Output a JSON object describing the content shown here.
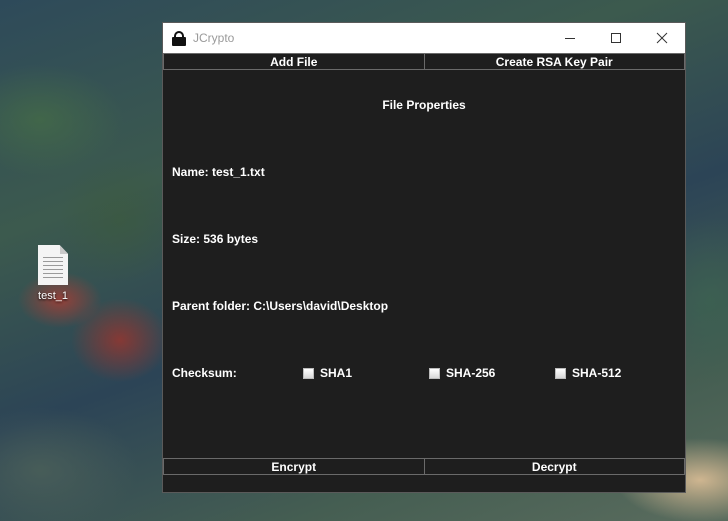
{
  "desktop": {
    "icon_label": "test_1",
    "icon": "text-file-icon"
  },
  "window": {
    "title": "JCrypto",
    "icon": "lock-icon",
    "controls": [
      "minimize-icon",
      "maximize-icon",
      "close-icon"
    ]
  },
  "toolbar": {
    "add_file": "Add File",
    "create_rsa": "Create RSA Key Pair"
  },
  "properties": {
    "heading": "File Properties",
    "name": "Name: test_1.txt",
    "size": "Size: 536 bytes",
    "parent": "Parent folder: C:\\Users\\david\\Desktop"
  },
  "checksum": {
    "label": "Checksum:",
    "options": [
      {
        "label": "SHA1",
        "checked": false
      },
      {
        "label": "SHA-256",
        "checked": false
      },
      {
        "label": "SHA-512",
        "checked": false
      }
    ]
  },
  "actions": {
    "encrypt": "Encrypt",
    "decrypt": "Decrypt"
  },
  "colors": {
    "window_bg": "#1e1e1e",
    "titlebar_bg": "#ffffff",
    "text": "#ffffff"
  }
}
